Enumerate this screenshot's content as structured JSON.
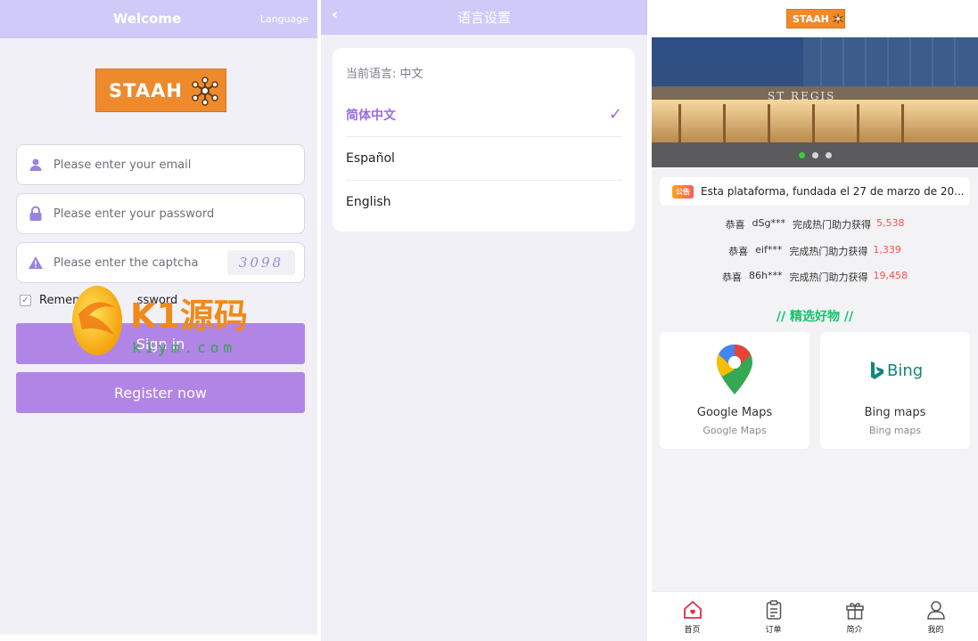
{
  "login": {
    "title": "Welcome",
    "language_link": "Language",
    "logo_text": "STAAH",
    "email_placeholder": "Please enter your email",
    "password_placeholder": "Please enter your password",
    "captcha_placeholder": "Please enter the captcha",
    "captcha_code": "3098",
    "remember_label_start": "Remem",
    "remember_label_end": "ssword",
    "signin_label": "Sign in",
    "register_label": "Register now",
    "watermark": {
      "brand": "K1源码",
      "domain": "k1ym.com"
    }
  },
  "language": {
    "title": "语言设置",
    "current_label": "当前语言: 中文",
    "options": [
      {
        "label": "简体中文",
        "selected": true
      },
      {
        "label": "Español",
        "selected": false
      },
      {
        "label": "English",
        "selected": false
      }
    ],
    "check_mark": "✓"
  },
  "home": {
    "logo_text": "STAAH",
    "banner_dots": [
      true,
      false,
      false
    ],
    "notice_tag": "公告",
    "notice_text": "Esta plataforma, fundada el 27 de marzo de 20...",
    "congrats": [
      {
        "prefix": "恭喜",
        "user": "dSg***",
        "text": "完成热门助力获得",
        "amount": "5,538"
      },
      {
        "prefix": "恭喜",
        "user": "eif***",
        "text": "完成热门助力获得",
        "amount": "1,339"
      },
      {
        "prefix": "恭喜",
        "user": "86h***",
        "text": "完成热门助力获得",
        "amount": "19,458"
      }
    ],
    "section_title": "// 精选好物 //",
    "products": [
      {
        "name": "Google Maps",
        "sub": "Google Maps",
        "icon": "google-maps-icon"
      },
      {
        "name": "Bing maps",
        "sub": "Bing maps",
        "icon": "bing-icon"
      }
    ],
    "bing_logo_text": "Bing",
    "tabs": [
      {
        "label": "首页",
        "icon": "home-icon",
        "active": true
      },
      {
        "label": "订单",
        "icon": "clipboard-icon",
        "active": false
      },
      {
        "label": "简介",
        "icon": "gift-icon",
        "active": false
      },
      {
        "label": "我的",
        "icon": "user-icon",
        "active": false
      }
    ]
  },
  "colors": {
    "header_purple": "#cfcaf8",
    "button_purple": "#b185e6",
    "accent_purple": "#9b6ce0",
    "logo_orange": "#ee8a2c",
    "amount_red": "#ff4f4f",
    "section_green": "#14c36a"
  }
}
